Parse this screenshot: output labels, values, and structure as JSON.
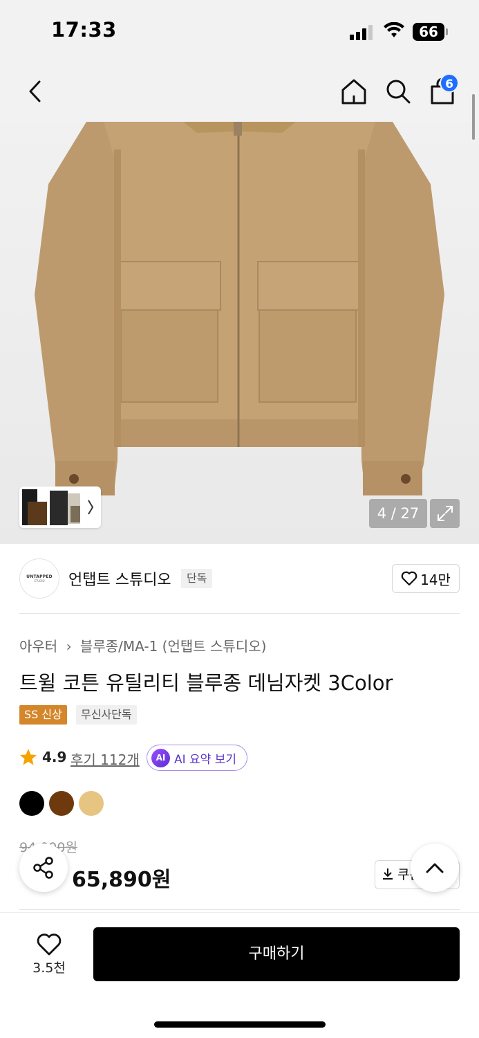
{
  "status_bar": {
    "time": "17:33",
    "battery": "66"
  },
  "nav": {
    "cart_count": "6"
  },
  "product_image": {
    "counter": "4 / 27"
  },
  "brand": {
    "logo_text": "UNTAPPED",
    "logo_sub": "STUDIO",
    "name": "언탭트 스튜디오",
    "tag": "단독",
    "like_count": "14만"
  },
  "product": {
    "breadcrumb": [
      "아우터",
      "블루종/MA-1 (언탭트 스튜디오)"
    ],
    "breadcrumb_sep": "›",
    "title": "트윌 코튼 유틸리티 블루종 데님자켓 3Color",
    "tags": [
      "SS 신상",
      "무신사단독"
    ],
    "rating": "4.9",
    "review_label": "후기 112개",
    "ai_badge": "AI",
    "ai_label": "AI 요약 보기",
    "colors": [
      "#000000",
      "#6e3a0d",
      "#e6c482"
    ],
    "original_price": "94,000원",
    "sale_price": "65,890원",
    "coupon_label": "쿠폰"
  },
  "bottom": {
    "like_count": "3.5천",
    "buy_label": "구매하기"
  },
  "icons": [
    "back-icon",
    "home-icon",
    "search-icon",
    "cart-icon",
    "chevron-right-icon",
    "expand-icon",
    "heart-icon",
    "star-icon",
    "share-icon",
    "chevron-up-icon",
    "download-icon"
  ]
}
